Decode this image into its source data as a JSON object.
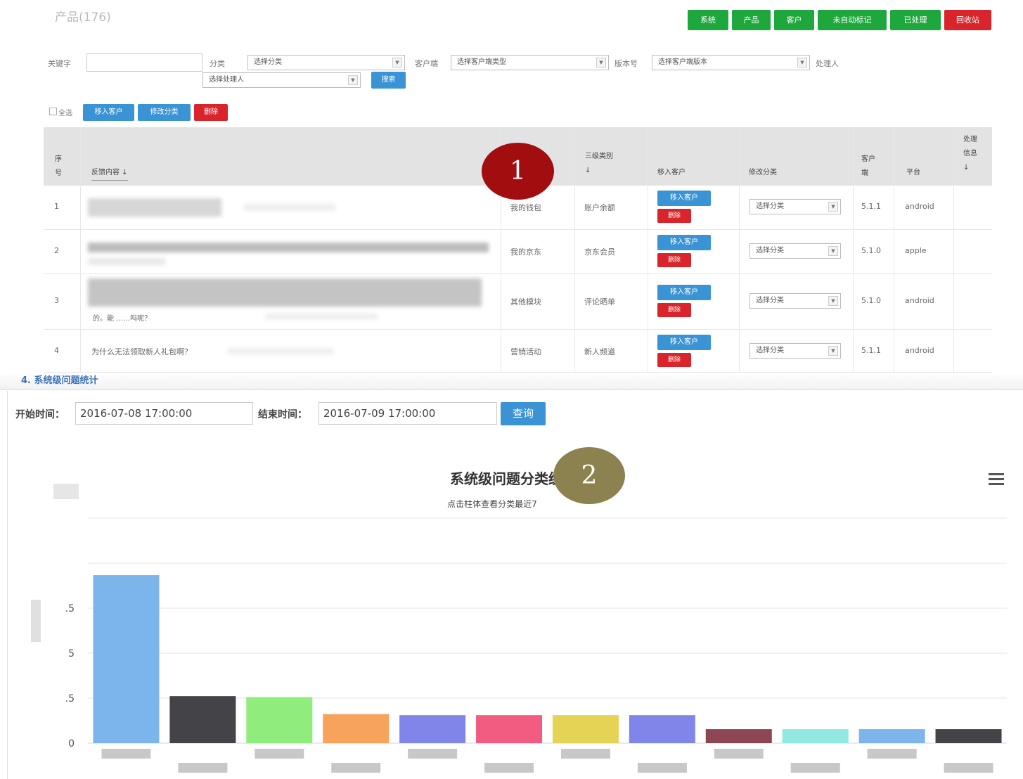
{
  "header": {
    "title": "产品(176)",
    "nav_buttons": [
      {
        "label": "系统",
        "color": "#1ea73c"
      },
      {
        "label": "产品",
        "color": "#1ea73c"
      },
      {
        "label": "客户",
        "color": "#1ea73c"
      },
      {
        "label": "未自动标记",
        "color": "#1ea73c"
      },
      {
        "label": "已处理",
        "color": "#1ea73c"
      },
      {
        "label": "回收站",
        "color": "#d9242c"
      }
    ]
  },
  "filters": {
    "keyword_label": "关键字",
    "category_label": "分类",
    "category_placeholder": "选择分类",
    "client_label": "客户端",
    "client_placeholder": "选择客户端类型",
    "version_label": "版本号",
    "version_placeholder": "选择客户端版本",
    "handler_label": "处理人",
    "handler_placeholder": "选择处理人",
    "search_label": "搜索"
  },
  "bulk": {
    "select_all": "全选",
    "move_customer": "移入客户",
    "modify_category": "修改分类",
    "delete": "删除"
  },
  "table": {
    "headers": {
      "index": "序号",
      "content": "反馈内容 ↓",
      "level3": "三级类别 ↓",
      "move": "移入客户",
      "modify": "修改分类",
      "client": "客户端",
      "platform": "平台",
      "handler": "处理信息↓"
    },
    "rows": [
      {
        "index": "1",
        "content": "",
        "level2": "我的钱包",
        "level3": "账户余额",
        "select": "选择分类",
        "version": "5.1.1",
        "platform": "android"
      },
      {
        "index": "2",
        "content": "",
        "level2": "我的京东",
        "level3": "京东会员",
        "select": "选择分类",
        "version": "5.1.0",
        "platform": "apple"
      },
      {
        "index": "3",
        "content": "的。能 ……吗呢？",
        "level2": "其他模块",
        "level3": "评论晒单",
        "select": "选择分类",
        "version": "5.1.0",
        "platform": "android"
      },
      {
        "index": "4",
        "content": "为什么无法领取新人礼包啊？",
        "level2": "营销活动",
        "level3": "新人频道",
        "select": "选择分类",
        "version": "5.1.1",
        "platform": "android"
      }
    ],
    "row_move_label": "移入客户",
    "row_delete_label": "删除"
  },
  "markers": {
    "one": "1",
    "two": "2"
  },
  "stats": {
    "section_title": "4. 系统级问题统计",
    "start_label": "开始时间：",
    "start_value": "2016-07-08 17:00:00",
    "end_label": "结束时间：",
    "end_value": "2016-07-09 17:00:00",
    "query_label": "查询"
  },
  "chart_data": {
    "type": "bar",
    "title": "系统级问题分类统",
    "subtitle": "点击柱体查看分类最近7",
    "yticks": [
      "0",
      ".5",
      "5",
      ".5",
      ""
    ],
    "values": [
      8.4,
      2.35,
      2.3,
      1.45,
      1.4,
      1.4,
      1.4,
      1.4,
      0.7,
      0.7,
      0.7,
      0.7
    ],
    "colors": [
      "#7cb5ec",
      "#434348",
      "#90ed7d",
      "#f7a35c",
      "#8085e9",
      "#f15c80",
      "#e4d354",
      "#8085e9",
      "#8d4653",
      "#91e8e1",
      "#7cb5ec",
      "#434348"
    ],
    "ylim": [
      0,
      11.25
    ],
    "grid": true
  }
}
